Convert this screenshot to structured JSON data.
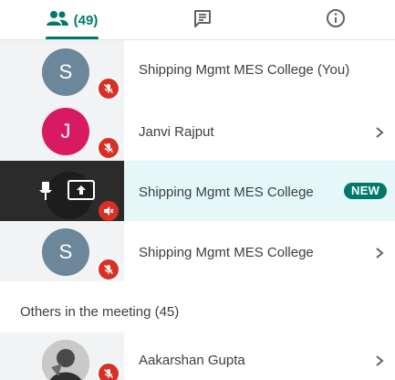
{
  "tabs": {
    "people_count": "(49)",
    "active": "people",
    "items": [
      {
        "id": "people",
        "icon": "people-icon"
      },
      {
        "id": "chat",
        "icon": "chat-icon"
      },
      {
        "id": "info",
        "icon": "info-icon"
      }
    ]
  },
  "participants": [
    {
      "initial": "S",
      "name": "Shipping Mgmt MES College (You)",
      "avatar_color": "#6b8799",
      "muted": true,
      "chevron": false
    },
    {
      "initial": "J",
      "name": "Janvi Rajput",
      "avatar_color": "#d81b60",
      "muted": true,
      "chevron": true
    },
    {
      "name": "Shipping Mgmt MES College",
      "muted": true,
      "badge": "NEW",
      "overlay_icons": [
        "pin-icon",
        "present-icon"
      ]
    },
    {
      "initial": "S",
      "name": "Shipping Mgmt MES College",
      "avatar_color": "#6b8799",
      "muted": true,
      "chevron": true
    }
  ],
  "others_section": {
    "title": "Others in the meeting (45)",
    "items": [
      {
        "name": "Aakarshan Gupta",
        "muted": true,
        "chevron": true,
        "avatar": "photo"
      }
    ]
  },
  "colors": {
    "accent": "#00796b",
    "mute_red": "#d93025",
    "active_row": "#e6f7f7"
  }
}
